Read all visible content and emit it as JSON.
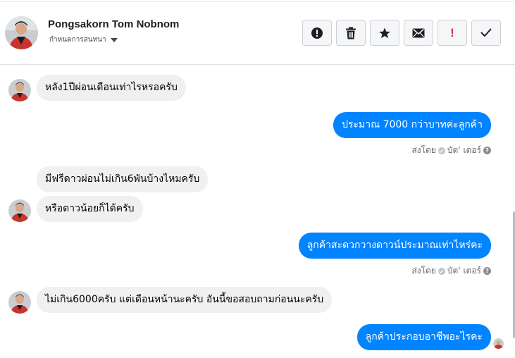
{
  "header": {
    "contact_name": "Pongsakorn Tom Nobnom",
    "subtitle": "กำหนดการสนทนา",
    "toolbar": [
      {
        "name": "report-button",
        "icon": "alert-circle-icon"
      },
      {
        "name": "delete-button",
        "icon": "trash-icon"
      },
      {
        "name": "star-button",
        "icon": "star-icon"
      },
      {
        "name": "mark-unread-button",
        "icon": "envelope-icon"
      },
      {
        "name": "spam-button",
        "icon": "exclamation-icon",
        "symbol": "!"
      },
      {
        "name": "done-button",
        "icon": "check-icon"
      }
    ]
  },
  "messages": [
    {
      "side": "in",
      "text": "หลัง1ปีผ่อนเดือนเท่าไรหรอครับ"
    },
    {
      "side": "out",
      "text": "ประมาณ 7000 กว่าบาทค่ะลูกค้า",
      "sent_by": "ส่งโดย",
      "agent": "บัต' เตอร์"
    },
    {
      "side": "in",
      "text": "มีฟรีดาวผ่อนไม่เกิน6พันบ้างไหมครับ"
    },
    {
      "side": "in",
      "text": "หรือดาวน้อยก็ได้ครับ"
    },
    {
      "side": "out",
      "text": "ลูกค้าสะดวกวางดาวน์ประมาณเท่าไหร่คะ",
      "sent_by": "ส่งโดย",
      "agent": "บัต' เตอร์"
    },
    {
      "side": "in",
      "text": "ไม่เกิน6000ครับ แต่เดือนหน้านะครับ อันนี้ขอสอบถามก่อนนะครับ"
    },
    {
      "side": "out",
      "text": "ลูกค้าประกอบอาชีพอะไรคะ"
    }
  ],
  "colors": {
    "outgoing_bubble": "#0084ff",
    "incoming_bubble": "#f0f0f0",
    "spam_icon": "#e0245e"
  }
}
